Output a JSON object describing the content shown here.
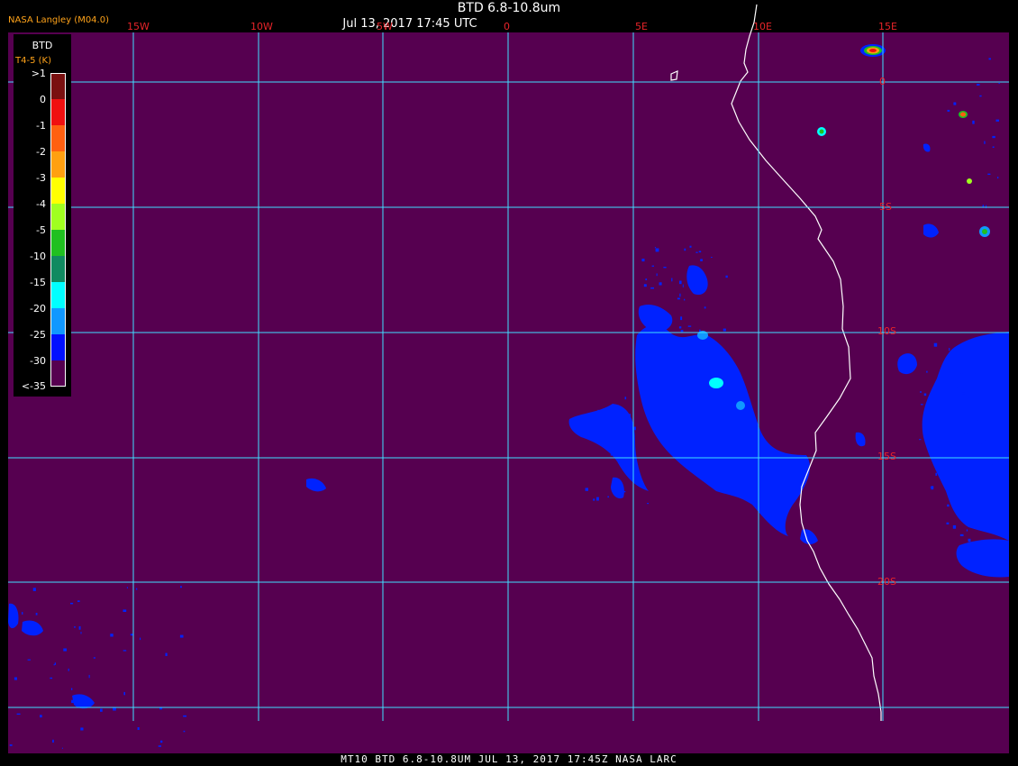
{
  "header": {
    "title": "BTD 6.8-10.8um",
    "datetime": "Jul 13, 2017 17:45 UTC",
    "brand": "NASA Langley (M04.0)"
  },
  "legend": {
    "title": "BTD",
    "subtitle": "T4-5 (K)",
    "labels": [
      ">1",
      "0",
      "-1",
      "-2",
      "-3",
      "-4",
      "-5",
      "-10",
      "-15",
      "-20",
      "-25",
      "-30",
      "<-35"
    ],
    "colors": [
      "#7a1010",
      "#f01010",
      "#ff6010",
      "#ffa010",
      "#ffff00",
      "#a0ff20",
      "#20c020",
      "#108a60",
      "#00ffff",
      "#1098ff",
      "#0010ff",
      "#560050"
    ]
  },
  "map": {
    "background": "#560050",
    "grid_color": "#40e0ff",
    "coast_color": "#ffffff",
    "cloud_color": "#0022ff",
    "lon_labels": [
      "15W",
      "10W",
      "5W",
      "0",
      "5E",
      "10E",
      "15E"
    ],
    "lat_labels": [
      "0",
      "5S",
      "10S",
      "15S",
      "20S"
    ]
  },
  "footer": {
    "text": "MT10  BTD 6.8-10.8UM   JUL 13, 2017 17:45Z   NASA LARC"
  }
}
